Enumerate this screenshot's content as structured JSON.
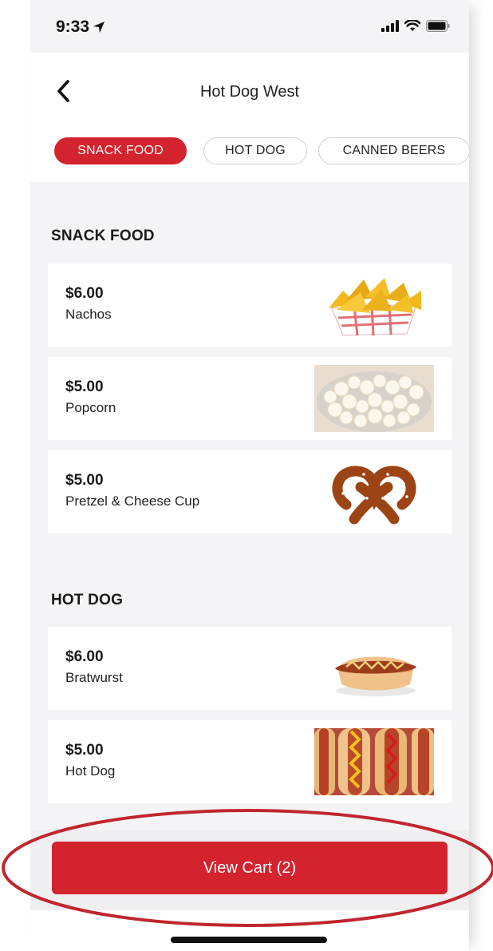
{
  "status_bar": {
    "time": "9:33"
  },
  "nav": {
    "title": "Hot Dog West"
  },
  "tabs": [
    {
      "label": "SNACK FOOD",
      "active": true
    },
    {
      "label": "HOT DOG",
      "active": false
    },
    {
      "label": "CANNED BEERS",
      "active": false
    }
  ],
  "sections": [
    {
      "title": "SNACK FOOD",
      "items": [
        {
          "price": "$6.00",
          "name": "Nachos",
          "image": "nachos"
        },
        {
          "price": "$5.00",
          "name": "Popcorn",
          "image": "popcorn"
        },
        {
          "price": "$5.00",
          "name": "Pretzel & Cheese Cup",
          "image": "pretzel"
        }
      ]
    },
    {
      "title": "HOT DOG",
      "items": [
        {
          "price": "$6.00",
          "name": "Bratwurst",
          "image": "bratwurst"
        },
        {
          "price": "$5.00",
          "name": "Hot Dog",
          "image": "hot-dogs"
        }
      ]
    }
  ],
  "cart": {
    "label": "View Cart (2)"
  },
  "colors": {
    "accent": "#d3232e",
    "background": "#f4f4f6",
    "card": "#ffffff",
    "highlight": "#c0262d"
  },
  "icons": [
    "location-arrow-icon",
    "signal-icon",
    "wifi-icon",
    "battery-icon",
    "back-chevron-icon"
  ]
}
